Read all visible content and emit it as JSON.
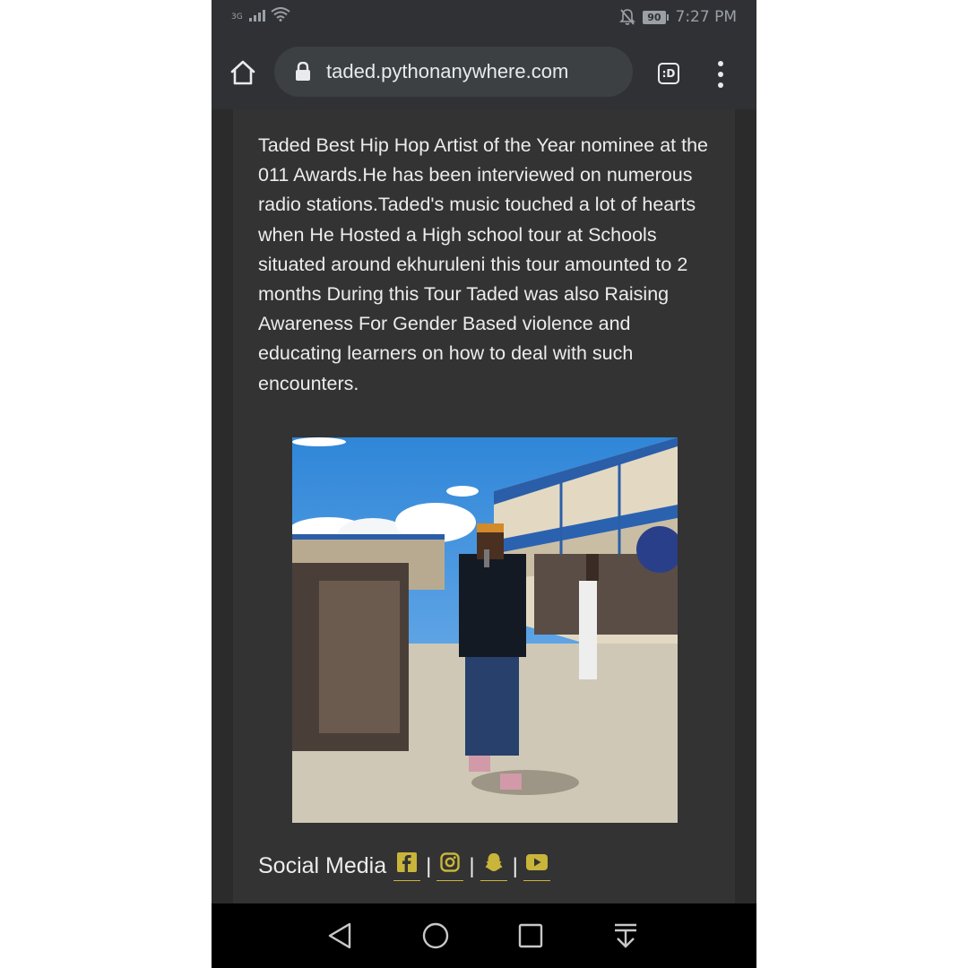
{
  "status_bar": {
    "network_type": "3G",
    "battery_level": "90",
    "time": "7:27 PM",
    "icons": [
      "signal-icon",
      "wifi-icon",
      "notifications-off-icon",
      "battery-icon"
    ]
  },
  "browser": {
    "url": "taded.pythonanywhere.com",
    "icons": [
      "home-icon",
      "lock-icon",
      "tab-switcher-icon",
      "more-vert-icon"
    ]
  },
  "page": {
    "paragraph": "Taded Best Hip Hop Artist of the Year nominee at the 011 Awards.He has been interviewed on numerous radio stations.Taded's music touched a lot of hearts when He Hosted a High school tour at Schools situated around ekhuruleni this tour amounted to 2 months During this Tour Taded was also Raising Awareness For Gender Based violence and educating learners on how to deal with such encounters.",
    "social_label": "Social Media",
    "separator": "|",
    "social_icons": [
      "facebook-icon",
      "instagram-icon",
      "snapchat-icon",
      "youtube-icon"
    ],
    "accent_color": "#c8b53a"
  },
  "nav_bar": {
    "icons": [
      "back-icon",
      "home-circle-icon",
      "recents-icon",
      "notification-pulldown-icon"
    ]
  }
}
